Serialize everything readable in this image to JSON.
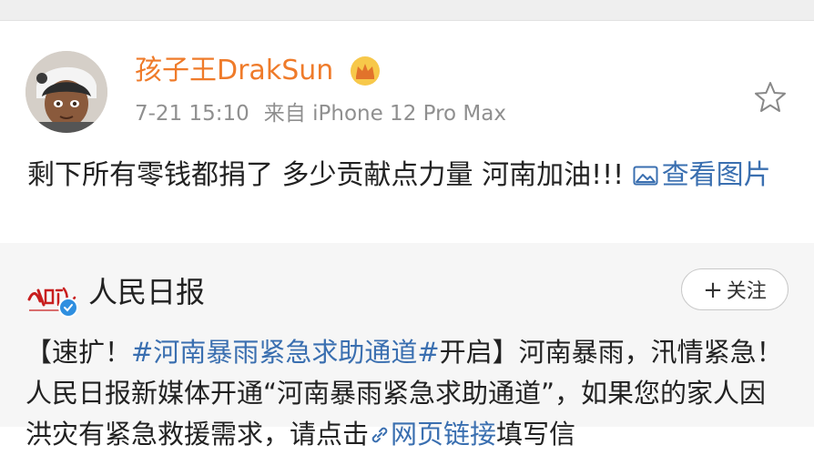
{
  "post": {
    "username": "孩子王DrakSun",
    "time": "7-21 15:10",
    "source": "来自 iPhone 12 Pro Max",
    "content_text": "剩下所有零钱都捐了 多少贡献点力量 河南加油!!! ",
    "view_image_label": "查看图片"
  },
  "repost": {
    "account_name": "人民日报",
    "follow_label": "关注",
    "follow_plus": "+",
    "text_prefix": "【速扩！",
    "hashtag": "#河南暴雨紧急求助通道#",
    "text_after_hashtag": "开启】河南暴雨，汛情紧急！人民日报新媒体开通“河南暴雨紧急求助通道”，如果您的家人因洪灾有紧急救援需求，请点击",
    "link_text": "网页链接",
    "text_tail": "填写信"
  },
  "colors": {
    "username": "#ef7b2a",
    "link": "#3a6fb0",
    "meta": "#8f8f8f",
    "repost_bg": "#f6f6f6",
    "verified": "#2f8fe0"
  },
  "icons": {
    "crown": "crown-icon",
    "star": "star-icon",
    "picture": "picture-icon",
    "verified": "verified-badge-icon",
    "link": "link-icon"
  }
}
